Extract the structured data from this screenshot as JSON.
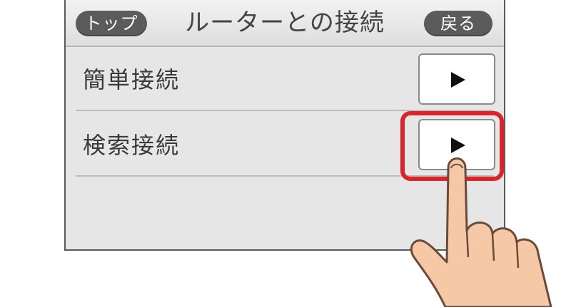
{
  "header": {
    "top_label": "トップ",
    "title": "ルーターとの接続",
    "back_label": "戻る"
  },
  "rows": [
    {
      "label": "簡単接続",
      "button_icon": "play-arrow-icon"
    },
    {
      "label": "検索接続",
      "button_icon": "play-arrow-icon"
    }
  ],
  "colors": {
    "screen_bg": "#e6e6e6",
    "pill_bg": "#5b5b5b",
    "highlight": "#d9252a",
    "hand_fill": "#f5c9a6",
    "hand_outline": "#6b4a3a"
  }
}
